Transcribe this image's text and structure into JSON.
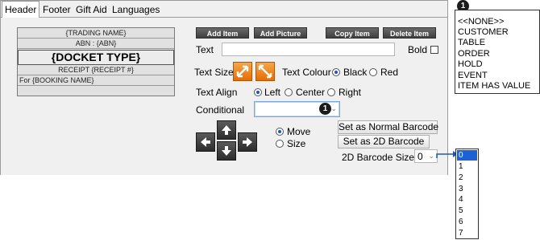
{
  "tabs": [
    "Header",
    "Footer",
    "Gift Aid",
    "Languages"
  ],
  "docket_lines": [
    "{TRADING NAME}",
    "ABN : {ABN}",
    "{DOCKET TYPE}",
    "RECEIPT {RECEIPT #}",
    "For {BOOKING NAME}"
  ],
  "toolbar": {
    "add_item": "Add Item",
    "add_picture": "Add Picture",
    "copy_item": "Copy Item",
    "delete_item": "Delete Item"
  },
  "text_field": {
    "label": "Text",
    "value": ""
  },
  "bold": {
    "label": "Bold",
    "checked": false
  },
  "text_size": {
    "label": "Text Size"
  },
  "text_colour": {
    "label": "Text Colour",
    "options": [
      "Black",
      "Red"
    ],
    "selected": "Black"
  },
  "text_align": {
    "label": "Text Align",
    "options": [
      "Left",
      "Center",
      "Right"
    ],
    "selected": "Left"
  },
  "conditional": {
    "label": "Conditional",
    "value": "",
    "badge": "1"
  },
  "move_size": {
    "options": [
      "Move",
      "Size"
    ],
    "selected": "Move"
  },
  "barcode_buttons": {
    "normal": "Set as Normal Barcode",
    "twod": "Set as 2D Barcode"
  },
  "barcode_size": {
    "label": "2D Barcode Size",
    "value": "0"
  },
  "callout": {
    "badge": "1",
    "items": [
      "<<NONE>>",
      "CUSTOMER",
      "TABLE",
      "ORDER",
      "HOLD",
      "EVENT",
      "ITEM HAS VALUE"
    ]
  },
  "barcode_size_options": {
    "items": [
      "0",
      "1",
      "2",
      "3",
      "4",
      "5",
      "6",
      "7"
    ],
    "selected": "0"
  },
  "colors": {
    "accent_blue": "#1c62d4",
    "button_orange": "#e56e06",
    "callout_arrow": "#1e5aa8"
  }
}
